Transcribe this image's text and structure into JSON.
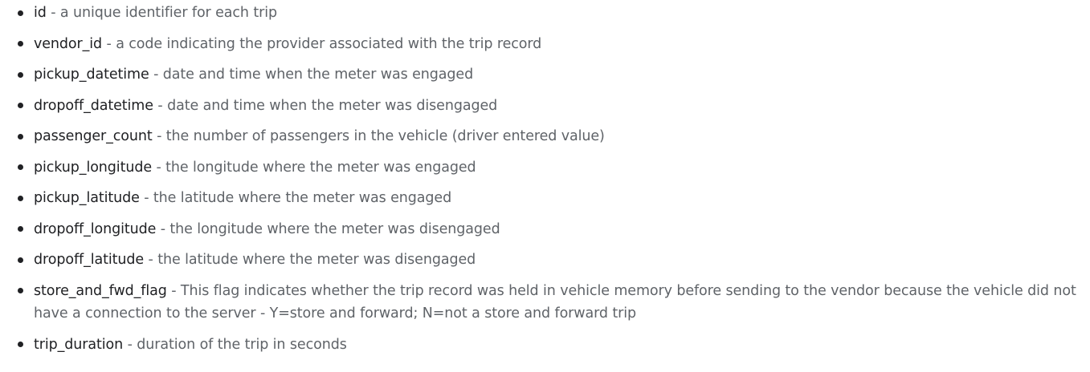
{
  "fields": [
    {
      "name": "id",
      "sep": " - ",
      "desc": "a unique identifier for each trip"
    },
    {
      "name": "vendor_id",
      "sep": " - ",
      "desc": "a code indicating the provider associated with the trip record"
    },
    {
      "name": "pickup_datetime",
      "sep": " - ",
      "desc": "date and time when the meter was engaged"
    },
    {
      "name": "dropoff_datetime",
      "sep": " - ",
      "desc": "date and time when the meter was disengaged"
    },
    {
      "name": "passenger_count",
      "sep": " - ",
      "desc": "the number of passengers in the vehicle (driver entered value)"
    },
    {
      "name": "pickup_longitude",
      "sep": " - ",
      "desc": "the longitude where the meter was engaged"
    },
    {
      "name": "pickup_latitude",
      "sep": " - ",
      "desc": "the latitude where the meter was engaged"
    },
    {
      "name": "dropoff_longitude",
      "sep": " - ",
      "desc": "the longitude where the meter was disengaged"
    },
    {
      "name": "dropoff_latitude",
      "sep": " - ",
      "desc": "the latitude where the meter was disengaged"
    },
    {
      "name": "store_and_fwd_flag",
      "sep": " - ",
      "desc": "This flag indicates whether the trip record was held in vehicle memory before sending to the vendor because the vehicle did not have a connection to the server - Y=store and forward; N=not a store and forward trip"
    },
    {
      "name": "trip_duration",
      "sep": " - ",
      "desc": "duration of the trip in seconds"
    }
  ]
}
